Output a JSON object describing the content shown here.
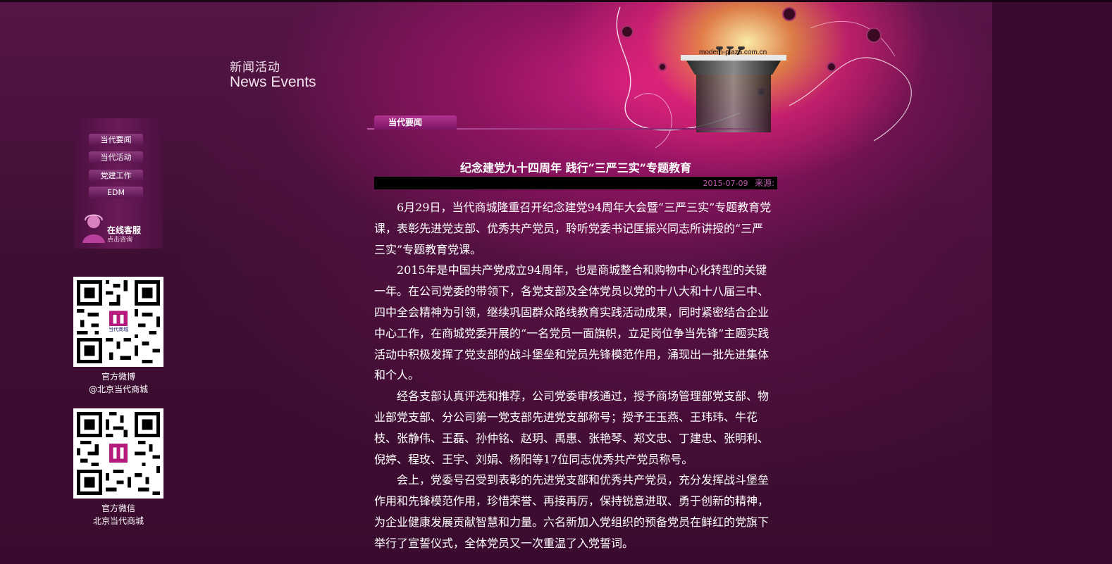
{
  "header": {
    "site_badge": "modern-plaza.com.cn",
    "section_title_cn": "新闻活动",
    "section_title_en": "News Events"
  },
  "sidebar": {
    "menu": [
      {
        "label": "当代要闻"
      },
      {
        "label": "当代活动"
      },
      {
        "label": "党建工作"
      },
      {
        "label": "EDM"
      }
    ],
    "online_service": {
      "label": "在线客服",
      "sub": "点击咨询"
    },
    "qr_codes": [
      {
        "caption_line1": "官方微博",
        "caption_line2": "@北京当代商城",
        "logo_text": "当代商城"
      },
      {
        "caption_line1": "官方微信",
        "caption_line2": "北京当代商城"
      }
    ]
  },
  "tabs": [
    {
      "label": "当代要闻",
      "active": true
    }
  ],
  "article": {
    "title": "纪念建党九十四周年 践行“三严三实”专题教育",
    "date": "2015-07-09",
    "source_label": "来源:",
    "paragraphs": [
      "6月29日，当代商城隆重召开纪念建党94周年大会暨“三严三实”专题教育党课，表彰先进党支部、优秀共产党员，聆听党委书记匡振兴同志所讲授的“三严三实”专题教育党课。",
      "2015年是中国共产党成立94周年，也是商城整合和购物中心化转型的关键一年。在公司党委的带领下，各党支部及全体党员以党的十八大和十八届三中、四中全会精神为引领，继续巩固群众路线教育实践活动成果，同时紧密结合企业中心工作，在商城党委开展的“一名党员一面旗帜，立足岗位争当先锋”主题实践活动中积极发挥了党支部的战斗堡垒和党员先锋模范作用，涌现出一批先进集体和个人。",
      "经各支部认真评选和推荐，公司党委审核通过，授予商场管理部党支部、物业部党支部、分公司第一党支部先进党支部称号；授予王玉燕、王玮玮、牛花枝、张静伟、王磊、孙仲铭、赵玥、禹惠、张艳琴、郑文忠、丁建忠、张明利、倪婷、程玫、王宇、刘娟、杨阳等17位同志优秀共产党员称号。",
      "会上，党委号召受到表彰的先进党支部和优秀共产党员，充分发挥战斗堡垒作用和先锋模范作用，珍惜荣誉、再接再厉，保持锐意进取、勇于创新的精神，为企业健康发展贡献智慧和力量。六名新加入党组织的预备党员在鲜红的党旗下举行了宣誓仪式，全体党员又一次重温了入党誓词。"
    ]
  },
  "colors": {
    "accent": "#c4187f",
    "meta_text": "#c15ab0"
  }
}
